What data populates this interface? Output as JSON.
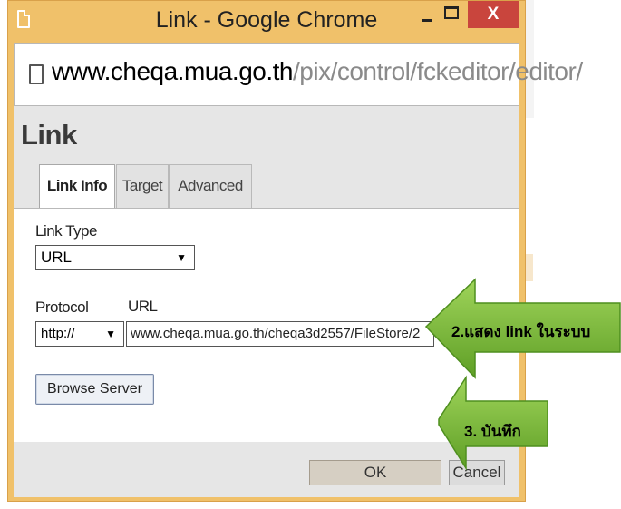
{
  "window": {
    "title": "Link - Google Chrome",
    "close_label": "X"
  },
  "address_bar": {
    "url_host": "www.cheqa.mua.go.th",
    "url_path": "/pix/control/fckeditor/editor/"
  },
  "dialog": {
    "title": "Link",
    "tabs": [
      {
        "label": "Link Info",
        "active": true
      },
      {
        "label": "Target",
        "active": false
      },
      {
        "label": "Advanced",
        "active": false
      }
    ],
    "link_type": {
      "label": "Link Type",
      "value": "URL"
    },
    "protocol": {
      "label": "Protocol",
      "value": "http://"
    },
    "url": {
      "label": "URL",
      "value": "www.cheqa.mua.go.th/cheqa3d2557/FileStore/2"
    },
    "browse_button": "Browse Server",
    "ok_button": "OK",
    "cancel_button": "Cancel"
  },
  "annotations": {
    "callout_1": "2.แสดง link ในระบบ",
    "callout_2": "3. บันทึก",
    "arrow_color": "#7fbf3a",
    "arrow_dark": "#4f8f1f"
  },
  "colors": {
    "window_frame": "#f0c16a",
    "close_button": "#c9453d"
  }
}
